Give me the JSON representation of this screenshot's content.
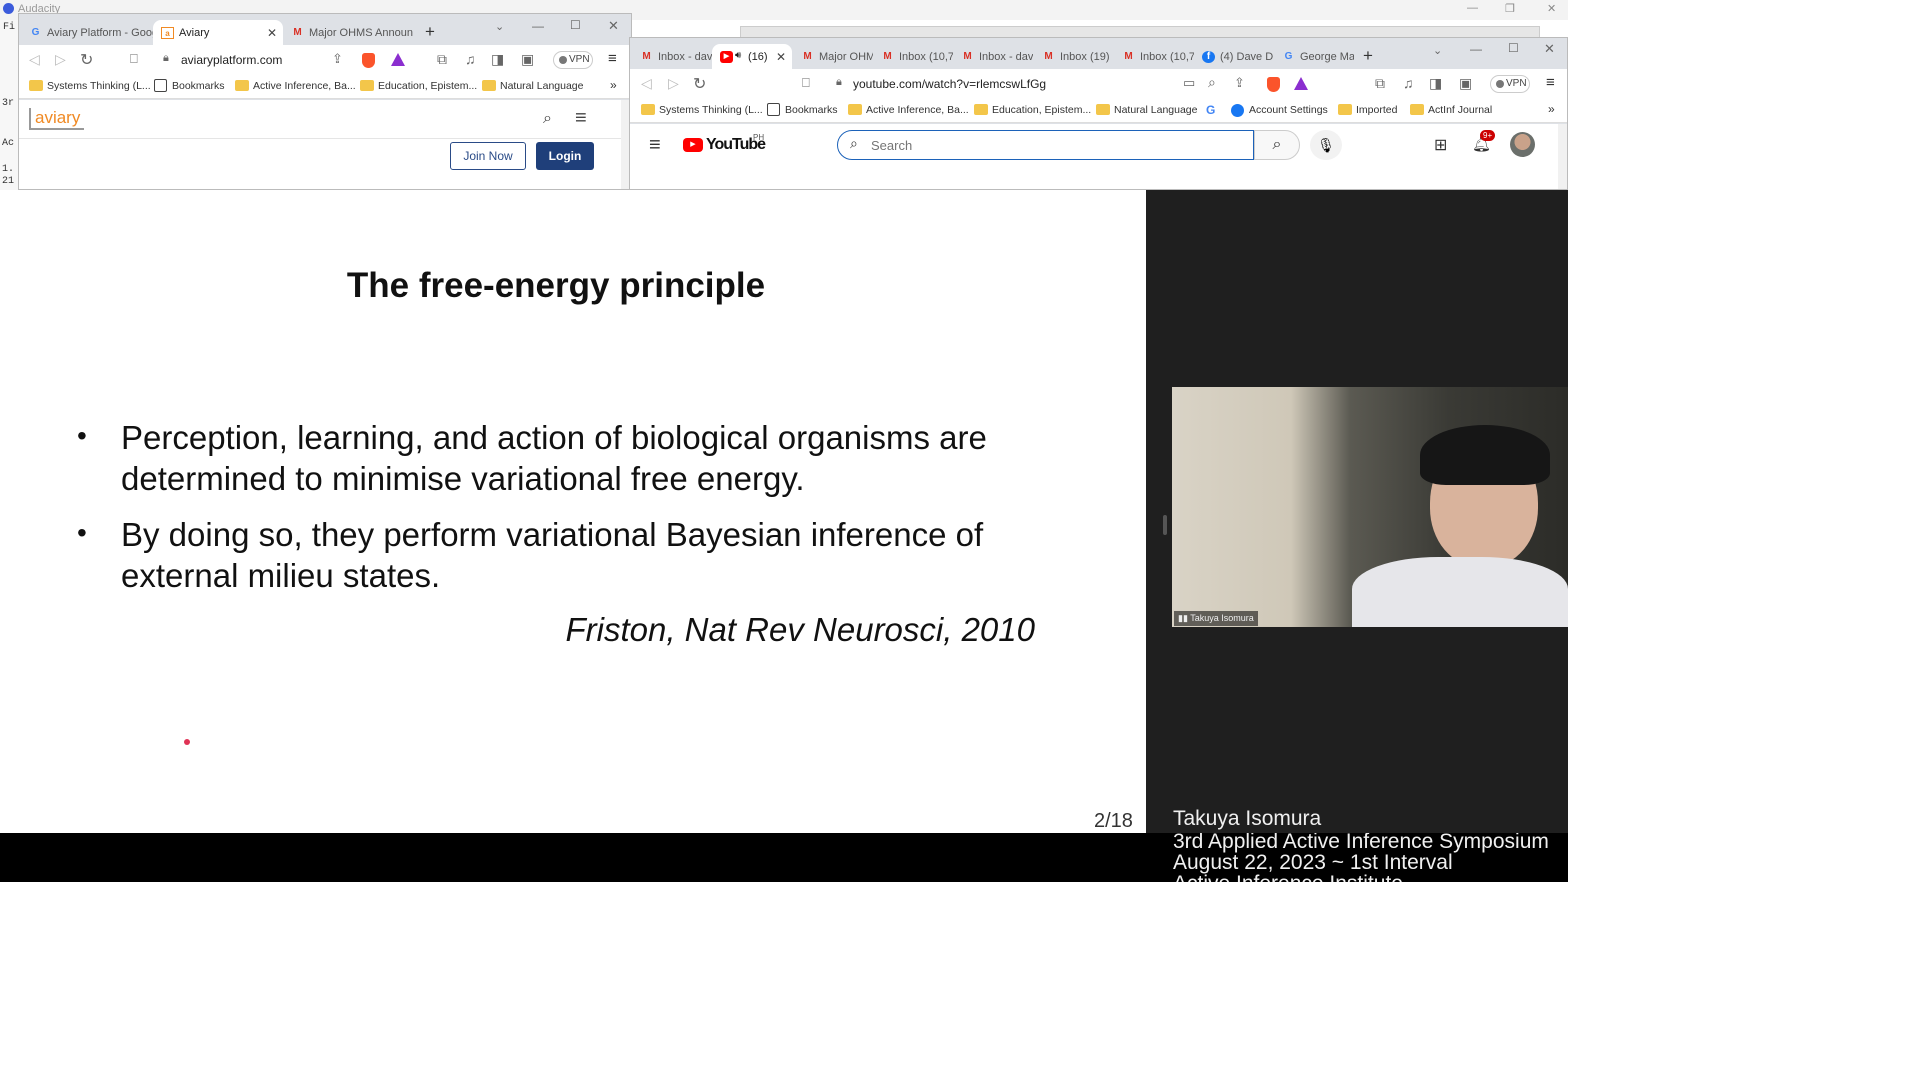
{
  "desktop": {
    "app_title": "Audacity"
  },
  "left_browser": {
    "tabs": [
      {
        "label": "Aviary Platform - Goog",
        "icon": "google-icon"
      },
      {
        "label": "Aviary",
        "icon": "aviary-icon",
        "active": true
      },
      {
        "label": "Major OHMS Announc",
        "icon": "gmail-icon"
      }
    ],
    "url": "aviaryplatform.com",
    "vpn_label": "VPN",
    "bookmarks": [
      "Systems Thinking (L...",
      "Bookmarks",
      "Active Inference, Ba...",
      "Education, Epistem...",
      "Natural Language"
    ],
    "site": {
      "logo": "aviary",
      "join_label": "Join Now",
      "login_label": "Login"
    }
  },
  "right_browser": {
    "tabs": [
      {
        "label": "Inbox - dav",
        "icon": "gmail-icon"
      },
      {
        "label": "(16)",
        "icon": "youtube-icon",
        "active": true
      },
      {
        "label": "Major OHM",
        "icon": "gmail-icon"
      },
      {
        "label": "Inbox (10,7",
        "icon": "gmail-icon"
      },
      {
        "label": "Inbox - dav",
        "icon": "gmail-icon"
      },
      {
        "label": "Inbox (19)",
        "icon": "gmail-icon"
      },
      {
        "label": "Inbox (10,7",
        "icon": "gmail-icon"
      },
      {
        "label": "(4) Dave D",
        "icon": "facebook-icon"
      },
      {
        "label": "George Ma",
        "icon": "google-icon"
      }
    ],
    "url": "youtube.com/watch?v=rlemcswLfGg",
    "vpn_label": "VPN",
    "bookmarks": [
      "Systems Thinking (L...",
      "Bookmarks",
      "Active Inference, Ba...",
      "Education, Epistem...",
      "Natural Language",
      "Account Settings",
      "Imported",
      "ActInf Journal"
    ],
    "youtube": {
      "logo": "YouTube",
      "region": "PH",
      "search_placeholder": "Search",
      "notif_badge": "9+"
    }
  },
  "slide": {
    "title": "The free-energy principle",
    "bullets": [
      [
        "Perception, learning, and action of biological organisms are",
        "determined to minimise variational free energy."
      ],
      [
        "By doing so, they perform variational Bayesian inference of",
        "external milieu states."
      ]
    ],
    "citation": "Friston, Nat Rev Neurosci, 2010",
    "page": "2/18"
  },
  "speaker": {
    "name_tag": "Takuya Isomura",
    "caption": [
      "Takuya Isomura",
      "3rd Applied Active Inference Symposium",
      "August 22, 2023 ~ 1st Interval",
      "Active Inference Institute"
    ]
  },
  "left_partial": {
    "lines": [
      "Fi",
      "3r",
      "Ac",
      "1.",
      "21"
    ]
  }
}
